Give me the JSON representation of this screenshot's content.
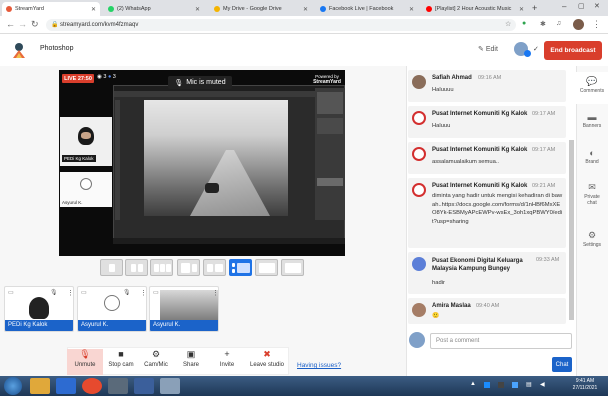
{
  "browser": {
    "tabs": [
      {
        "title": "StreamYard",
        "color": "#e65a3a"
      },
      {
        "title": "(2) WhatsApp",
        "color": "#25d366"
      },
      {
        "title": "My Drive - Google Drive",
        "color": "#f4b400"
      },
      {
        "title": "Facebook Live | Facebook",
        "color": "#1877f2"
      },
      {
        "title": "[Playlist] 2 Hour Acoustic Music",
        "color": "#ff0000"
      }
    ],
    "url": "streamyard.com/kvm4fzmaqv"
  },
  "header": {
    "title": "Photoshop",
    "edit_label": "Edit",
    "end_broadcast_label": "End broadcast"
  },
  "stage": {
    "live_badge": "LIVE 27:50",
    "viewers": "3",
    "likes": "3",
    "mic_muted": "Mic is muted",
    "powered_by": "Powered by",
    "powered_brand": "StreamYard",
    "cam1_label": "PEDi Kg Kalok",
    "cam2_label": "Asyurul K."
  },
  "participants": [
    {
      "name": "PEDi Kg Kalok"
    },
    {
      "name": "Asyurul K."
    },
    {
      "name": "Asyurul K."
    }
  ],
  "toolbar": [
    {
      "label": "Unmute",
      "icon": "mic-off-icon",
      "glyph": "🎙"
    },
    {
      "label": "Stop cam",
      "icon": "camera-icon",
      "glyph": "■"
    },
    {
      "label": "Cam/Mic",
      "icon": "gear-icon",
      "glyph": "⚙"
    },
    {
      "label": "Share",
      "icon": "share-screen-icon",
      "glyph": "▣"
    },
    {
      "label": "Invite",
      "icon": "add-person-icon",
      "glyph": "+"
    },
    {
      "label": "Leave studio",
      "icon": "leave-icon",
      "glyph": "✕"
    }
  ],
  "having_issues": "Having issues?",
  "chat": {
    "messages": [
      {
        "name": "Safiah Ahmad",
        "time": "09:16 AM",
        "text": "Haluuuu",
        "avatar_color": "#8a6d5a"
      },
      {
        "name": "Pusat Internet Komuniti Kg Kalok",
        "time": "09:17 AM",
        "text": "Haluuu",
        "avatar_color": "#d32f2f"
      },
      {
        "name": "Pusat Internet Komuniti Kg Kalok",
        "time": "09:17 AM",
        "text": "assalamualaikum semua..",
        "avatar_color": "#d32f2f"
      },
      {
        "name": "Pusat Internet Komuniti Kg Kalok",
        "time": "09:21 AM",
        "text": "diminta yang hadir untuk mengisi kehadiran di bawah..https://docs.google.com/forms/d/1nHBf6MxXEO8Yk-ESBMyAPcEWPv-wsEx_3oh1xqPBWY0/edit?usp=sharing",
        "avatar_color": "#d32f2f"
      },
      {
        "name": "Pusat Ekonomi Digital Keluarga Malaysia Kampung Bungey",
        "time": "09:33 AM",
        "text": "hadir",
        "avatar_color": "#5c7fd8"
      },
      {
        "name": "Amira Maslaa",
        "time": "09:40 AM",
        "text": "🙂",
        "avatar_color": "#a57d66"
      }
    ],
    "input_placeholder": "Post a comment",
    "send_label": "Chat"
  },
  "rail": [
    {
      "label": "Comments",
      "icon": "comments-icon",
      "glyph": "💬"
    },
    {
      "label": "Banners",
      "icon": "banners-icon",
      "glyph": "▬"
    },
    {
      "label": "Brand",
      "icon": "palette-icon",
      "glyph": "◐"
    },
    {
      "label": "Private chat",
      "icon": "private-chat-icon",
      "glyph": "✉"
    },
    {
      "label": "Settings",
      "icon": "settings-icon",
      "glyph": "⚙"
    }
  ],
  "taskbar": {
    "time": "9:41 AM",
    "date": "27/11/2021"
  }
}
